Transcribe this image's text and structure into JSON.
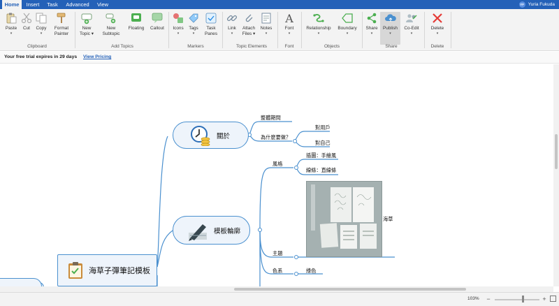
{
  "menu": {
    "tabs": [
      {
        "label": "Home",
        "active": true
      },
      {
        "label": "Insert"
      },
      {
        "label": "Task"
      },
      {
        "label": "Advanced"
      },
      {
        "label": "View"
      }
    ],
    "user": {
      "initials": "YF",
      "name": "Yuria Fukuda"
    }
  },
  "ribbon": {
    "buttons": [
      {
        "label": "Paste",
        "caret": "▾",
        "icon": "paste-icon"
      },
      {
        "label": "Cut",
        "icon": "scissors-icon"
      },
      {
        "label": "Copy",
        "caret": "▾",
        "icon": "copy-icon"
      },
      {
        "label": "Format",
        "label2": "Painter",
        "caret": "▾",
        "icon": "format-painter-icon"
      },
      {
        "label": "New",
        "label2": "Topic",
        "caret": "▾",
        "icon": "new-topic-icon"
      },
      {
        "label": "New",
        "label2": "Subtopic",
        "icon": "new-subtopic-icon"
      },
      {
        "label": "Floating",
        "icon": "floating-topic-icon"
      },
      {
        "label": "Callout",
        "icon": "callout-icon"
      },
      {
        "label": "Icons",
        "caret": "▾",
        "icon": "icons-marker-icon"
      },
      {
        "label": "Tags",
        "caret": "▾",
        "icon": "tag-icon"
      },
      {
        "label": "Task",
        "label2": "Panes",
        "icon": "task-panes-icon"
      },
      {
        "label": "Link",
        "caret": "▾",
        "icon": "link-icon"
      },
      {
        "label": "Attach",
        "label2": "Files",
        "caret": "▾",
        "icon": "attach-icon"
      },
      {
        "label": "Notes",
        "caret": "▾",
        "icon": "notes-icon"
      },
      {
        "label": "Font",
        "caret": "▾",
        "icon": "font-icon"
      },
      {
        "label": "Relationship",
        "caret": "▾",
        "icon": "relationship-icon"
      },
      {
        "label": "Boundary",
        "caret": "▾",
        "icon": "boundary-icon"
      },
      {
        "label": "Share",
        "caret": "▾",
        "icon": "share-icon"
      },
      {
        "label": "Publish",
        "caret": "▾",
        "icon": "publish-cloud-icon",
        "pressed": true
      },
      {
        "label": "Co-Edit",
        "caret": "▾",
        "icon": "co-edit-icon"
      },
      {
        "label": "Delete",
        "caret": "▾",
        "icon": "delete-icon"
      }
    ],
    "groups": [
      "Clipboard",
      "Add Topics",
      "Markers",
      "Topic Elements",
      "Font",
      "Objects",
      "Share",
      "Delete"
    ]
  },
  "trial": {
    "message": "Your free trial expires in 29 days",
    "link": "View Pricing"
  },
  "mindmap": {
    "central": "海草子彈筆記模板",
    "topics": [
      {
        "label": "關於",
        "icon": "clock-coins-icon"
      },
      {
        "label": "模板輪廓",
        "icon": "pen-paper-icon"
      }
    ],
    "subtopics": {
      "about_period": "整體期間",
      "about_why": "為什麼要做？",
      "why_users": "對用戶",
      "why_self": "對自己",
      "style": "風格",
      "style_illustration": "插圖：手繪風",
      "style_lines": "線條：直線條",
      "theme": "主題",
      "theme_value": "海草",
      "color": "色系",
      "color_value": "綠色"
    },
    "colors": {
      "line": "#4a90cf",
      "fill": "#eef4fb"
    }
  },
  "status": {
    "zoom": "103%",
    "zoom_level": 1.03
  }
}
